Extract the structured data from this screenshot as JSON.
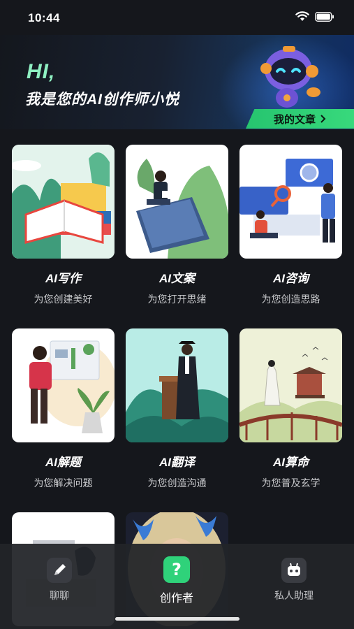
{
  "status": {
    "time": "10:44"
  },
  "banner": {
    "greeting": "HI,",
    "subtitle": "我是您的AI创作师小悦",
    "my_articles_label": "我的文章"
  },
  "cards": [
    {
      "title": "AI写作",
      "subtitle": "为您创建美好"
    },
    {
      "title": "AI文案",
      "subtitle": "为您打开思绪"
    },
    {
      "title": "AI咨询",
      "subtitle": "为您创造思路"
    },
    {
      "title": "AI解题",
      "subtitle": "为您解决问题"
    },
    {
      "title": "AI翻译",
      "subtitle": "为您创造沟通"
    },
    {
      "title": "AI算命",
      "subtitle": "为您普及玄学"
    }
  ],
  "tabbar": {
    "tabs": [
      {
        "label": "聊聊",
        "icon": "pencil-icon"
      },
      {
        "label": "创作者",
        "icon": "question-icon"
      },
      {
        "label": "私人助理",
        "icon": "robot-icon"
      }
    ],
    "active_index": 1
  },
  "colors": {
    "accent_green": "#2fd27a",
    "background": "#15171c"
  }
}
